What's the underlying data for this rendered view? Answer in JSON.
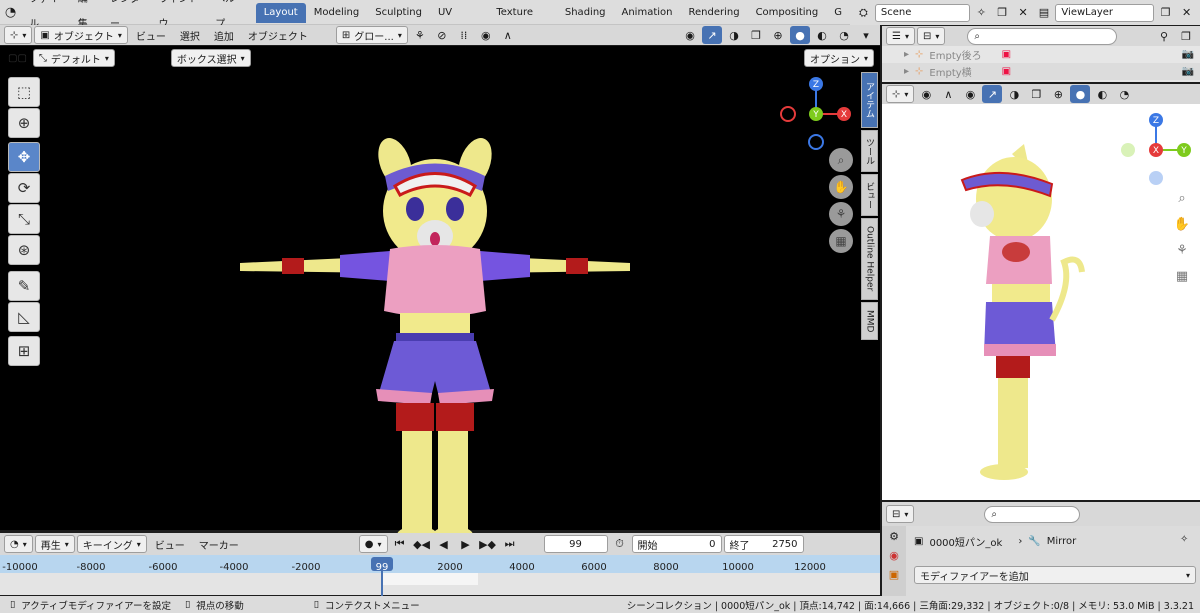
{
  "topbar": {
    "menus": [
      "ファイル",
      "編集",
      "レンダー",
      "ウィンドウ",
      "ヘルプ"
    ],
    "workspaces": [
      "Layout",
      "Modeling",
      "Sculpting",
      "UV Editing",
      "Texture Paint",
      "Shading",
      "Animation",
      "Rendering",
      "Compositing",
      "G"
    ],
    "scene": "Scene",
    "viewlayer": "ViewLayer"
  },
  "viewport": {
    "mode": "オブジェクト",
    "menus": [
      "ビュー",
      "選択",
      "追加",
      "オブジェクト"
    ],
    "orientation": "グロー...",
    "transform": "デフォルト",
    "select_mode": "ボックス選択",
    "options": "オプション",
    "side_tabs": [
      "アイテム",
      "ツール",
      "ビュー",
      "Outline Helper",
      "MMD"
    ]
  },
  "outliner": {
    "rows": [
      "Empty後ろ",
      "Empty横"
    ]
  },
  "properties": {
    "object": "0000短パン_ok",
    "modifier": "Mirror",
    "add_modifier": "モディファイアーを追加"
  },
  "timeline": {
    "playback": "再生",
    "keying": "キーイング",
    "menus": [
      "ビュー",
      "マーカー"
    ],
    "current_frame": "99",
    "start_label": "開始",
    "start": "0",
    "end_label": "終了",
    "end": "2750",
    "ticks": [
      "-10000",
      "-8000",
      "-6000",
      "-4000",
      "-2000",
      "99",
      "2000",
      "4000",
      "6000",
      "8000",
      "10000",
      "12000"
    ]
  },
  "status": {
    "left1": "アクティブモディファイアーを設定",
    "left2": "視点の移動",
    "mid": "コンテクストメニュー",
    "right": "シーンコレクション | 0000短パン_ok | 頂点:14,742 | 面:14,666 | 三角面:29,332 | オブジェクト:0/8 | メモリ: 53.0 MiB | 3.3.21"
  },
  "colors": {
    "accent": "#4772b3",
    "axis_x": "#e53b3b",
    "axis_y": "#7ecb1d",
    "axis_z": "#3b78e5"
  }
}
